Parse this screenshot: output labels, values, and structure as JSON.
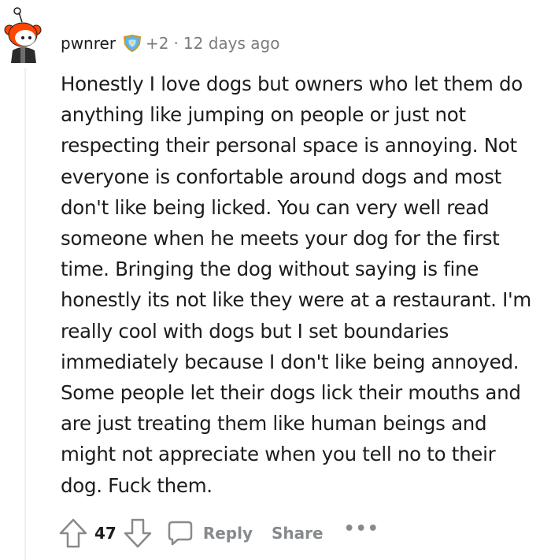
{
  "comment": {
    "username": "pwnrer",
    "karma": "+2",
    "separator": "·",
    "timestamp": "12 days ago",
    "body": "Honestly I love dogs but owners who let them do\nanything like jumping on people or just not\nrespecting their personal space is annoying. Not\neveryone is confortable around dogs and most\ndon't like being licked. You can very well read\nsomeone when he meets your dog for the first\ntime. Bringing the dog without saying is fine\nhonestly its not like they were at a restaurant. I'm\nreally cool with dogs but I set boundaries\nimmediately because I don't like being annoyed.\nSome people let their dogs lick their mouths and\nare just treating them like human beings and\nmight not appreciate when you tell no to their\ndog. Fuck them.",
    "vote_count": "47"
  },
  "actions": {
    "reply_label": "Reply",
    "share_label": "Share",
    "more_label": "•••"
  },
  "icons": {
    "avatar": "reddit-snoo-avatar",
    "flair": "award-shield-icon",
    "upvote": "upvote-arrow-icon",
    "downvote": "downvote-arrow-icon",
    "reply": "comment-bubble-icon"
  },
  "colors": {
    "text": "#1c1c1c",
    "muted": "#787c7e",
    "action_gray": "#878a8c",
    "snoo_red": "#ff4500"
  }
}
